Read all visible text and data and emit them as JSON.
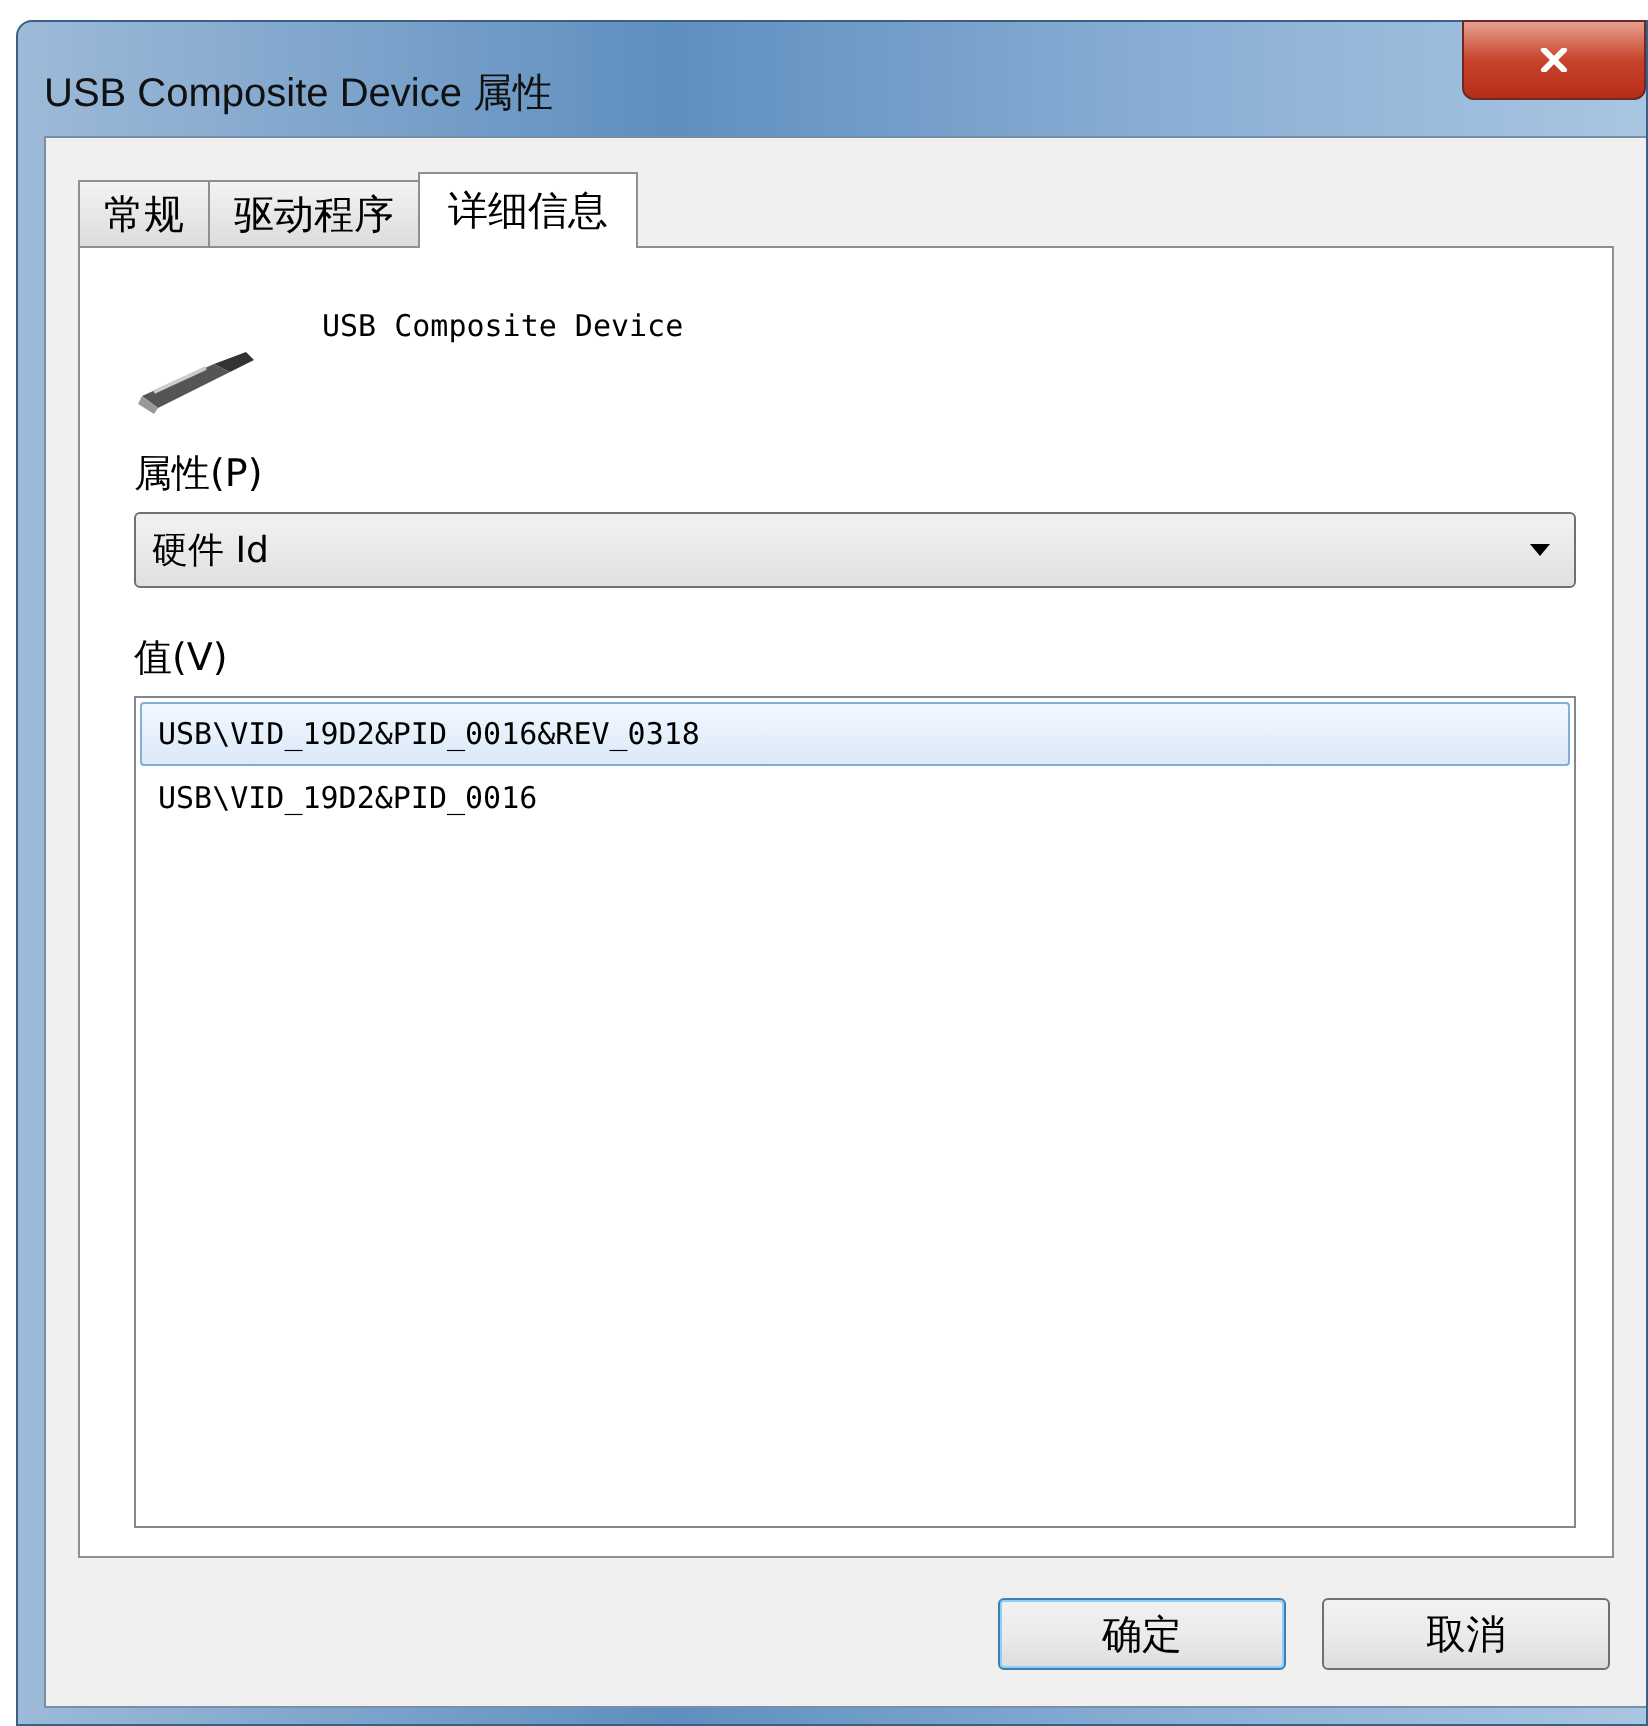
{
  "window": {
    "title": "USB Composite Device 属性"
  },
  "tabs": [
    {
      "label": "常规",
      "selected": false
    },
    {
      "label": "驱动程序",
      "selected": false
    },
    {
      "label": "详细信息",
      "selected": true
    }
  ],
  "device_name": "USB Composite Device",
  "property": {
    "label": "属性(P)",
    "value": "硬件 Id"
  },
  "values": {
    "label": "值(V)",
    "items": [
      {
        "text": "USB\\VID_19D2&PID_0016&REV_0318",
        "selected": true
      },
      {
        "text": "USB\\VID_19D2&PID_0016",
        "selected": false
      }
    ]
  },
  "buttons": [
    {
      "label": "确定",
      "default": true
    },
    {
      "label": "取消",
      "default": false
    }
  ]
}
